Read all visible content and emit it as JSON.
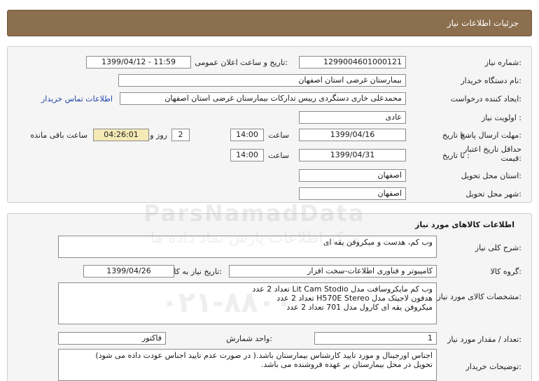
{
  "header": {
    "title": "جزئیات اطلاعات نیاز"
  },
  "details": {
    "need_number_label": "شماره نیاز:",
    "need_number": "1299004601000121",
    "announce_label": "تاریخ و ساعت اعلان عمومی:",
    "announce_value": "1399/04/12 - 11:59",
    "buyer_label": "نام دستگاه خریدار:",
    "buyer": "بیمارستان غرضی استان اصفهان",
    "creator_label": "ایجاد کننده درخواست:",
    "creator": "محمدعلی خاری دستگردی رییس تدارکات بیمارستان غرضی استان اصفهان",
    "contact_link": "اطلاعات تماس خریدار",
    "priority_label": "اولویت نیاز :",
    "priority": "عادی",
    "deadline_label": "مهلت ارسال پاسخ:",
    "to_date_label": "تا تاریخ :",
    "deadline_date": "1399/04/16",
    "hour_label": "ساعت",
    "deadline_time": "14:00",
    "days_value": "2",
    "days_label": "روز و",
    "remaining_time": "04:26:01",
    "remaining_label": "ساعت باقی مانده",
    "min_validity_label": "حداقل تاریخ اعتبار قیمت:",
    "validity_date": "1399/04/31",
    "validity_time": "14:00",
    "province_label": "استان محل تحویل:",
    "province": "اصفهان",
    "city_label": "شهر محل تحویل:",
    "city": "اصفهان"
  },
  "goods": {
    "section_title": "اطلاعات کالاهای مورد نیاز",
    "summary_label": "شرح کلی نیاز:",
    "summary": "وب کم، هدست و میکروفن یقه ای",
    "group_label": "گروه کالا:",
    "group": "کامپیوتر و فناوری اطلاعات-سخت افزار",
    "need_date_label": "تاریخ نیاز به کالا:",
    "need_date": "1399/04/26",
    "specs_label": "مشخصات کالای مورد نیاز:",
    "specs_lines": [
      "وب کم مایکروسافت مدل Lit Cam Stodio تعداد 2 عدد",
      "هدفون لاجیتک مدل H570E Stereo تعداد 2 عدد",
      "میکروفن یقه ای کارول مدل 701 تعداد 2 عدد"
    ],
    "qty_label": "تعداد / مقدار مورد نیاز:",
    "qty": "1",
    "unit_label": "واحد شمارش:",
    "unit": "فاکتور",
    "buyer_notes_label": "توضیحات خریدار:",
    "buyer_notes_lines": [
      "اجناس اورجینال و مورد تایید کارشناس بیمارستان باشد.( در صورت عدم تایید اجناس عودت داده می شود)",
      "تحویل در محل بیمارستان بر عهده فروشنده می باشد."
    ]
  },
  "watermark": {
    "brand": "ParsNamadData",
    "sub": "مرکز اطلاعات پارس نماد داده ها",
    "phone": "۰۲۱-۸۸۰۰"
  }
}
